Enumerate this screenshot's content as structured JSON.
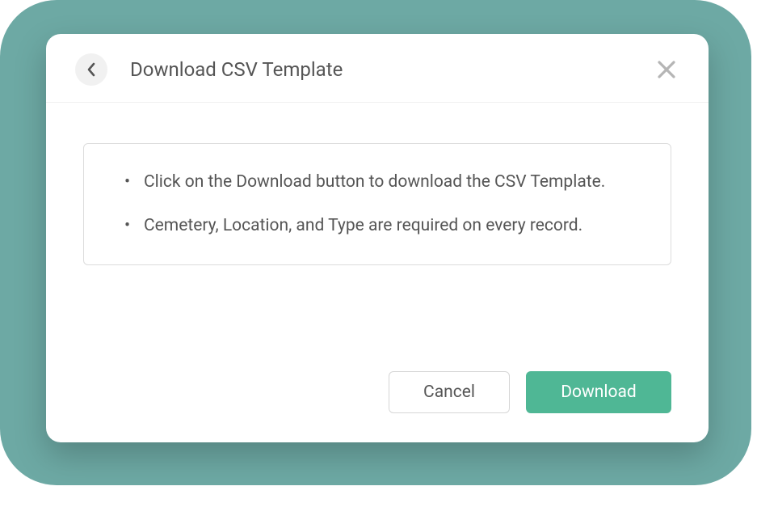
{
  "modal": {
    "title": "Download CSV Template",
    "instructions": {
      "item1": "Click on the Download button to download the CSV Template.",
      "item2": "Cemetery, Location, and Type are required on every record."
    },
    "buttons": {
      "cancel": "Cancel",
      "download": "Download"
    }
  }
}
